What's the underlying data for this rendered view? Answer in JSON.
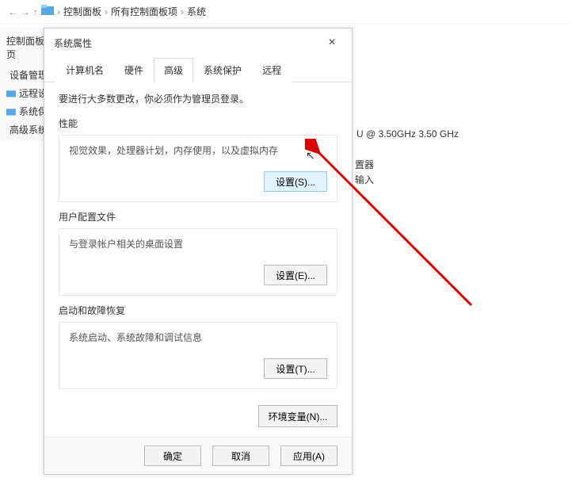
{
  "breadcrumb": {
    "p1": "控制面板",
    "p2": "所有控制面板项",
    "p3": "系统"
  },
  "sidebar_title": "控制面板主页",
  "sidebar": [
    {
      "label": "设备管理器"
    },
    {
      "label": "远程设置"
    },
    {
      "label": "系统保护"
    },
    {
      "label": "高级系统设置"
    }
  ],
  "bg": {
    "cpu": "U @ 3.50GHz   3.50 GHz",
    "pen": "置器",
    "input": "输入"
  },
  "dialog": {
    "title": "系统属性",
    "tabs": {
      "t0": "计算机名",
      "t1": "硬件",
      "t2": "高级",
      "t3": "系统保护",
      "t4": "远程"
    },
    "note": "要进行大多数更改，你必须作为管理员登录。",
    "perf": {
      "title": "性能",
      "desc": "视觉效果，处理器计划，内存使用，以及虚拟内存",
      "btn": "设置(S)..."
    },
    "profile": {
      "title": "用户配置文件",
      "desc": "与登录帐户相关的桌面设置",
      "btn": "设置(E)..."
    },
    "startup": {
      "title": "启动和故障恢复",
      "desc": "系统启动、系统故障和调试信息",
      "btn": "设置(T)..."
    },
    "env_btn": "环境变量(N)...",
    "ok": "确定",
    "cancel": "取消",
    "apply": "应用(A)"
  }
}
